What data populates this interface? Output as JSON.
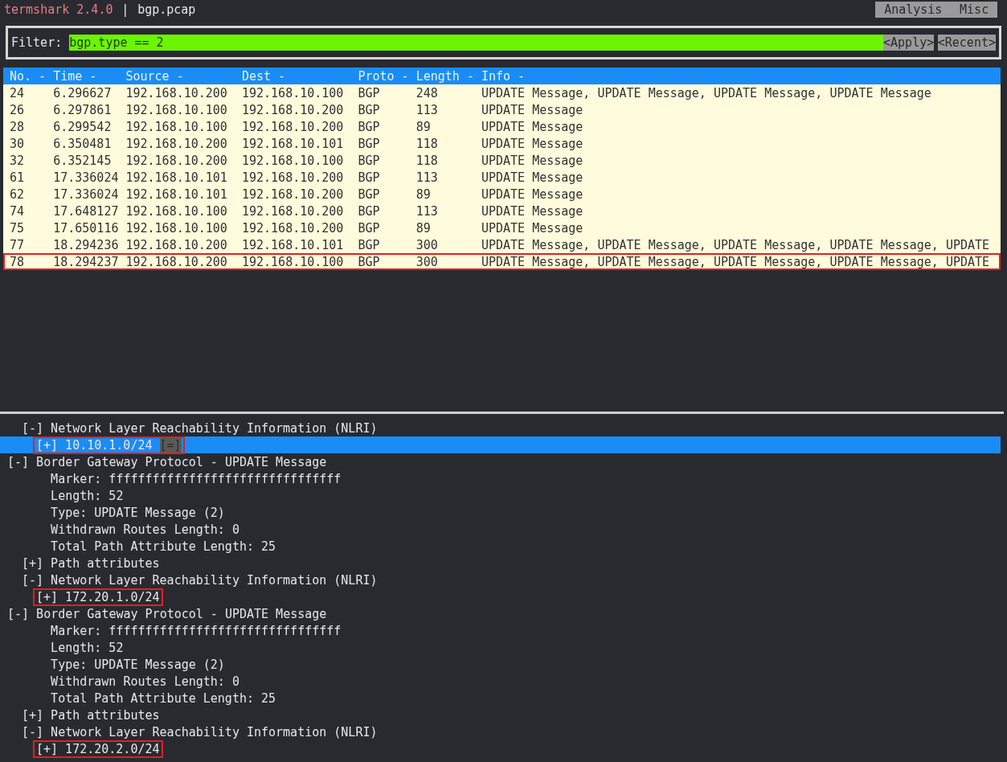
{
  "title_bar": {
    "app": "termshark 2.4.0",
    "separator": "|",
    "file": "bgp.pcap",
    "menu": [
      {
        "label": "Analysis"
      },
      {
        "label": "Misc"
      }
    ]
  },
  "filter": {
    "label": "Filter:",
    "value": "bgp.type == 2",
    "buttons": [
      "<Apply>",
      "<Recent>"
    ]
  },
  "table": {
    "columns": [
      "No. -",
      "Time -",
      "Source -",
      "Dest -",
      "Proto -",
      "Length -",
      "Info -"
    ],
    "rows": [
      {
        "cells": [
          "24",
          "6.296627",
          "192.168.10.200",
          "192.168.10.100",
          "BGP",
          "248",
          "UPDATE Message, UPDATE Message, UPDATE Message, UPDATE Message"
        ],
        "outlined": false
      },
      {
        "cells": [
          "26",
          "6.297861",
          "192.168.10.100",
          "192.168.10.200",
          "BGP",
          "113",
          "UPDATE Message"
        ],
        "outlined": false
      },
      {
        "cells": [
          "28",
          "6.299542",
          "192.168.10.100",
          "192.168.10.200",
          "BGP",
          "89",
          "UPDATE Message"
        ],
        "outlined": false
      },
      {
        "cells": [
          "30",
          "6.350481",
          "192.168.10.200",
          "192.168.10.101",
          "BGP",
          "118",
          "UPDATE Message"
        ],
        "outlined": false
      },
      {
        "cells": [
          "32",
          "6.352145",
          "192.168.10.200",
          "192.168.10.100",
          "BGP",
          "118",
          "UPDATE Message"
        ],
        "outlined": false
      },
      {
        "cells": [
          "61",
          "17.336024",
          "192.168.10.101",
          "192.168.10.200",
          "BGP",
          "113",
          "UPDATE Message"
        ],
        "outlined": false
      },
      {
        "cells": [
          "62",
          "17.336024",
          "192.168.10.101",
          "192.168.10.200",
          "BGP",
          "89",
          "UPDATE Message"
        ],
        "outlined": false
      },
      {
        "cells": [
          "74",
          "17.648127",
          "192.168.10.100",
          "192.168.10.200",
          "BGP",
          "113",
          "UPDATE Message"
        ],
        "outlined": false
      },
      {
        "cells": [
          "75",
          "17.650116",
          "192.168.10.100",
          "192.168.10.200",
          "BGP",
          "89",
          "UPDATE Message"
        ],
        "outlined": false
      },
      {
        "cells": [
          "77",
          "18.294236",
          "192.168.10.200",
          "192.168.10.101",
          "BGP",
          "300",
          "UPDATE Message, UPDATE Message, UPDATE Message, UPDATE Message, UPDATE"
        ],
        "outlined": false
      },
      {
        "cells": [
          "78",
          "18.294237",
          "192.168.10.200",
          "192.168.10.100",
          "BGP",
          "300",
          "UPDATE Message, UPDATE Message, UPDATE Message, UPDATE Message, UPDATE"
        ],
        "outlined": true
      }
    ]
  },
  "tree": [
    {
      "children": [
        {
          "toggle": "[-]",
          "label": "Network Layer Reachability Information (NLRI)",
          "selected": false,
          "children": [
            {
              "toggle": "[+]",
              "label": "10.10.1.0/24",
              "marker": "[=]",
              "selected": true,
              "outlined": true
            }
          ]
        }
      ]
    },
    {
      "toggle": "[-]",
      "label": "Border Gateway Protocol - UPDATE Message",
      "selected": false,
      "children": [
        {
          "label": "Marker: ffffffffffffffffffffffffffffffff",
          "selected": false
        },
        {
          "label": "Length: 52",
          "selected": false
        },
        {
          "label": "Type: UPDATE Message (2)",
          "selected": false
        },
        {
          "label": "Withdrawn Routes Length: 0",
          "selected": false
        },
        {
          "label": "Total Path Attribute Length: 25",
          "selected": false
        },
        {
          "toggle": "[+]",
          "label": "Path attributes",
          "selected": false
        },
        {
          "toggle": "[-]",
          "label": "Network Layer Reachability Information (NLRI)",
          "selected": false,
          "children": [
            {
              "toggle": "[+]",
              "label": "172.20.1.0/24",
              "selected": false,
              "outlined": true
            }
          ]
        }
      ]
    },
    {
      "toggle": "[-]",
      "label": "Border Gateway Protocol - UPDATE Message",
      "selected": false,
      "children": [
        {
          "label": "Marker: ffffffffffffffffffffffffffffffff",
          "selected": false
        },
        {
          "label": "Length: 52",
          "selected": false
        },
        {
          "label": "Type: UPDATE Message (2)",
          "selected": false
        },
        {
          "label": "Withdrawn Routes Length: 0",
          "selected": false
        },
        {
          "label": "Total Path Attribute Length: 25",
          "selected": false
        },
        {
          "toggle": "[+]",
          "label": "Path attributes",
          "selected": false
        },
        {
          "toggle": "[-]",
          "label": "Network Layer Reachability Information (NLRI)",
          "selected": false,
          "children": [
            {
              "toggle": "[+]",
              "label": "172.20.2.0/24",
              "selected": false,
              "outlined": true
            }
          ]
        }
      ]
    }
  ]
}
